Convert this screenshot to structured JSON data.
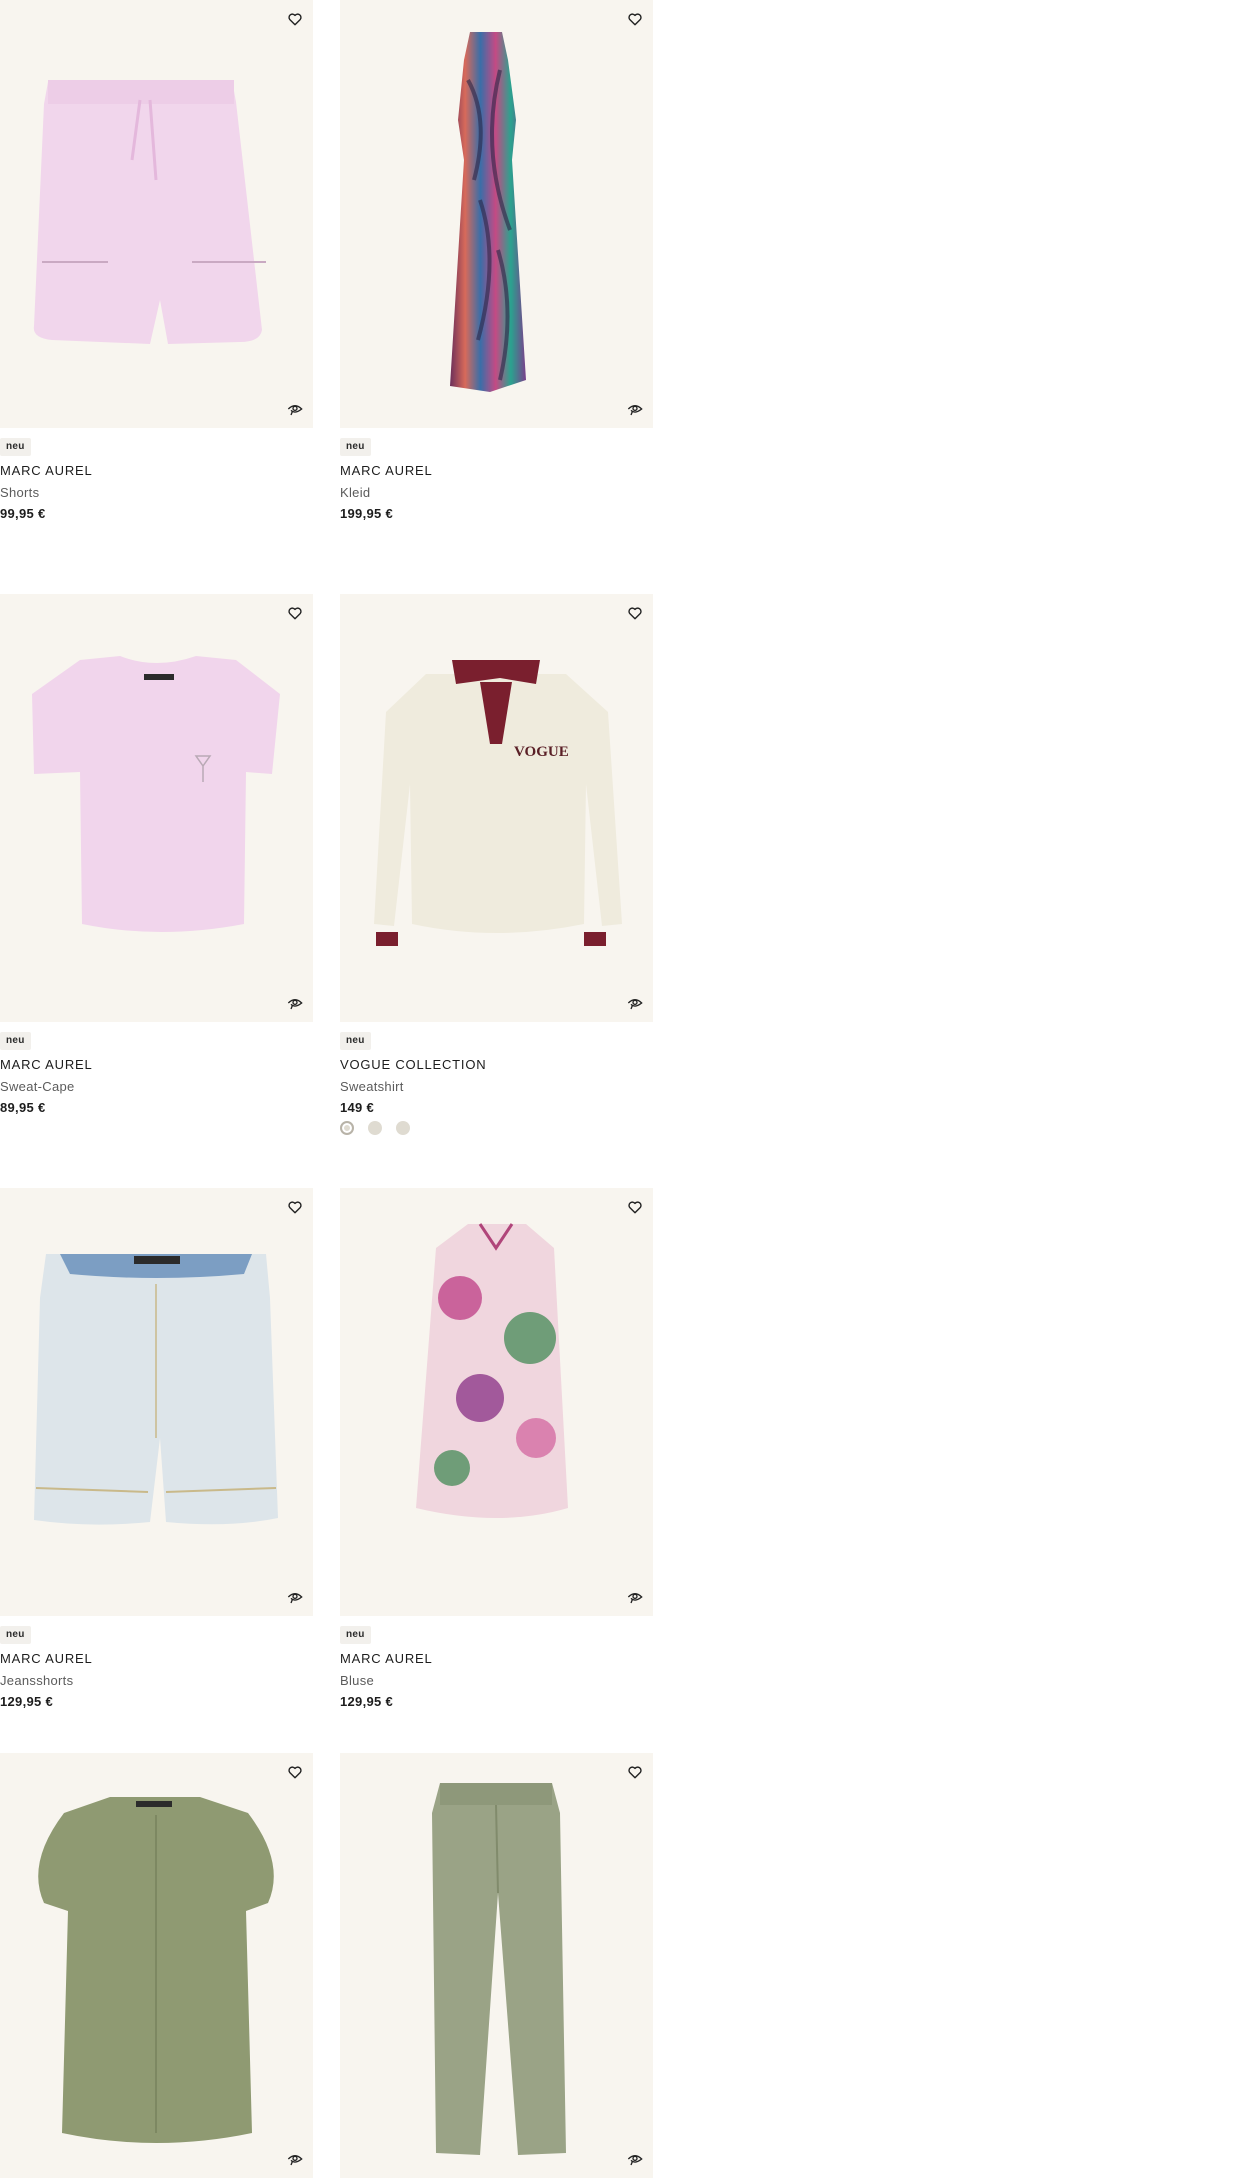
{
  "products": [
    {
      "badge": "neu",
      "brand": "MARC AUREL",
      "type": "Shorts",
      "price": "99,95 €",
      "image": "pink shorts with drawstring",
      "wishlist_icon": "heart-icon",
      "similar_icon": "similar-items-icon"
    },
    {
      "badge": "neu",
      "brand": "MARC AUREL",
      "type": "Kleid",
      "price": "199,95 €",
      "image": "multicolour swirl print maxi dress",
      "wishlist_icon": "heart-icon",
      "similar_icon": "similar-items-icon"
    },
    {
      "badge": "neu",
      "brand": "MARC AUREL",
      "type": "Sweat-Cape",
      "price": "89,95 €",
      "image": "pink short-sleeve sweat top",
      "wishlist_icon": "heart-icon",
      "similar_icon": "similar-items-icon"
    },
    {
      "badge": "neu",
      "brand": "VOGUE COLLECTION",
      "type": "Sweatshirt",
      "price": "149 €",
      "image": "cream polo sweatshirt with burgundy collar and VOGUE print",
      "print_text": "VOGUE",
      "swatches": [
        "#dfdbd1",
        "#dfdbd1",
        "#dfdbd1"
      ],
      "wishlist_icon": "heart-icon",
      "similar_icon": "similar-items-icon"
    },
    {
      "badge": "neu",
      "brand": "MARC AUREL",
      "type": "Jeansshorts",
      "price": "129,95 €",
      "image": "light blue denim shorts",
      "wishlist_icon": "heart-icon",
      "similar_icon": "similar-items-icon"
    },
    {
      "badge": "neu",
      "brand": "MARC AUREL",
      "type": "Bluse",
      "price": "129,95 €",
      "image": "sleeveless paisley print blouse",
      "wishlist_icon": "heart-icon",
      "similar_icon": "similar-items-icon"
    },
    {
      "badge": "",
      "brand": "",
      "type": "",
      "price": "",
      "image": "khaki blouse with ruffle sleeves",
      "wishlist_icon": "heart-icon",
      "similar_icon": "similar-items-icon"
    },
    {
      "badge": "",
      "brand": "",
      "type": "",
      "price": "",
      "image": "khaki jogger trousers",
      "wishlist_icon": "heart-icon",
      "similar_icon": "similar-items-icon"
    }
  ],
  "colors": {
    "image_bg": "#f8f5ef",
    "badge_bg": "#f2f0ec",
    "text": "#1d1d1d",
    "subtext": "#5b5b5b"
  }
}
